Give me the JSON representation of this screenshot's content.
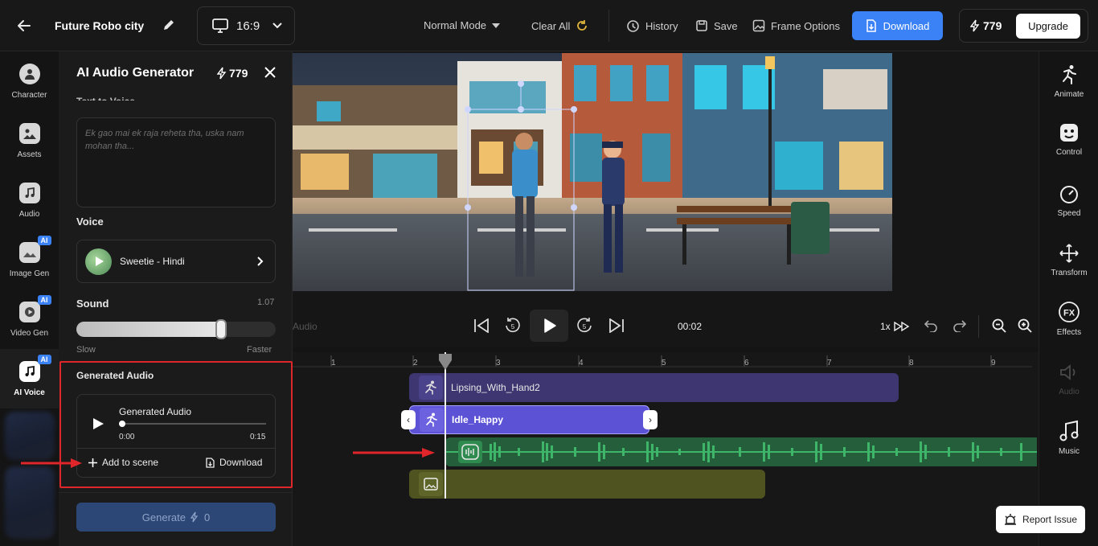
{
  "header": {
    "project_title": "Future Robo city",
    "aspect_ratio": "16:9",
    "mode": "Normal Mode",
    "clear_all": "Clear All",
    "history": "History",
    "save": "Save",
    "frame_options": "Frame Options",
    "download": "Download",
    "credits": "779",
    "upgrade": "Upgrade"
  },
  "left_rail": {
    "items": [
      {
        "label": "Character",
        "icon": "character-icon"
      },
      {
        "label": "Assets",
        "icon": "assets-icon"
      },
      {
        "label": "Audio",
        "icon": "audio-icon"
      },
      {
        "label": "Image Gen",
        "icon": "image-gen-icon",
        "badge": "AI"
      },
      {
        "label": "Video Gen",
        "icon": "video-gen-icon",
        "badge": "AI"
      },
      {
        "label": "AI Voice",
        "icon": "ai-voice-icon",
        "badge": "AI"
      }
    ]
  },
  "panel": {
    "title": "AI Audio Generator",
    "credits": "779",
    "section_text_to_voice": "Text to Voice",
    "text_placeholder": "Ek gao mai ek raja reheta tha, uska nam mohan tha...",
    "voice_label": "Voice",
    "voice_name": "Sweetie - Hindi",
    "sound_label": "Sound",
    "sound_value": "1.07",
    "sound_fraction": 0.74,
    "slow_label": "Slow",
    "faster_label": "Faster",
    "generated_heading": "Generated Audio",
    "player": {
      "title": "Generated Audio",
      "current_time": "0:00",
      "duration": "0:15",
      "progress": 0.0
    },
    "add_to_scene": "Add to scene",
    "download": "Download",
    "generate_label": "Generate",
    "generate_cost": "0"
  },
  "right_rail": {
    "items": [
      {
        "label": "Animate",
        "icon": "animate-icon",
        "enabled": true
      },
      {
        "label": "Control",
        "icon": "control-icon",
        "enabled": true
      },
      {
        "label": "Speed",
        "icon": "speed-icon",
        "enabled": true
      },
      {
        "label": "Transform",
        "icon": "transform-icon",
        "enabled": true
      },
      {
        "label": "Effects",
        "icon": "effects-icon",
        "enabled": true
      },
      {
        "label": "Audio",
        "icon": "audio-icon",
        "enabled": false
      },
      {
        "label": "Music",
        "icon": "music-icon",
        "enabled": true
      }
    ]
  },
  "playback": {
    "left_label": "Audio",
    "time": "00:02",
    "speed": "1x"
  },
  "timeline": {
    "ticks": [
      "1",
      "2",
      "3",
      "4",
      "5",
      "6",
      "7",
      "8",
      "9"
    ],
    "tracks": [
      {
        "name": "Lipsing_With_Hand2",
        "type": "animation"
      },
      {
        "name": "Idle_Happy",
        "type": "animation"
      },
      {
        "name": "",
        "type": "audio"
      },
      {
        "name": "",
        "type": "background"
      }
    ]
  },
  "report_issue": "Report Issue",
  "colors": {
    "accent": "#3b82f6",
    "annotation_red": "#e0262a",
    "audio_track": "#2f8a4f",
    "anim_track": "#3d3670",
    "selected_track": "#5c52d6",
    "background_track": "#4f5320"
  }
}
